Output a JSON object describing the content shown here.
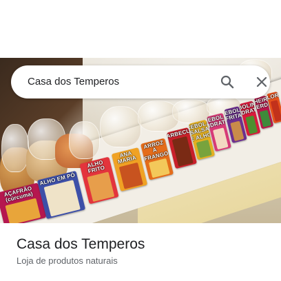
{
  "search": {
    "query": "Casa dos Temperos"
  },
  "place": {
    "title": "Casa dos Temperos",
    "subtitle": "Loja de produtos naturais"
  },
  "photo": {
    "labels": [
      "AÇAFRÃO (cúrcuma)",
      "ALHO EM PÓ",
      "ALHO FRITO",
      "ANA MARIA",
      "ARROZ À FRANGO",
      "BARBECUE",
      "CEBOLA SALSA E ALHO",
      "CEBOLA DESIDRATADA",
      "CEBOLA FRITA",
      "CEBOLINHA DESIDRATADA",
      "CHEIRO VERDE",
      "COLORAU"
    ]
  },
  "icons": {
    "search": "search-icon",
    "close": "close-icon"
  },
  "colors": {
    "title": "#202124",
    "subtitle": "#5f6368",
    "icon": "#5f6368"
  }
}
